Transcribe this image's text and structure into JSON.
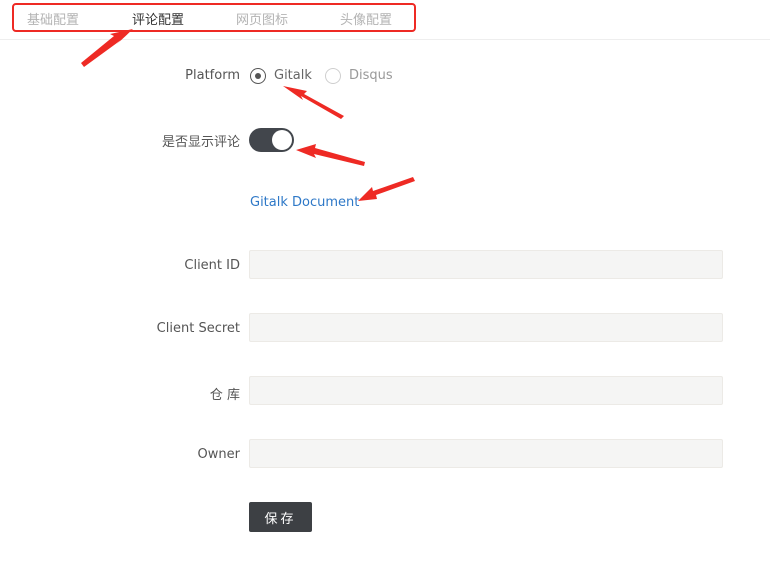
{
  "tabs": [
    {
      "label": "基础配置",
      "active": false
    },
    {
      "label": "评论配置",
      "active": true
    },
    {
      "label": "网页图标",
      "active": false
    },
    {
      "label": "头像配置",
      "active": false
    }
  ],
  "form": {
    "platform_label": "Platform",
    "platform_options": [
      {
        "label": "Gitalk",
        "checked": true
      },
      {
        "label": "Disqus",
        "checked": false
      }
    ],
    "show_comments_label": "是否显示评论",
    "show_comments_on": true,
    "doc_link": "Gitalk Document",
    "client_id_label": "Client ID",
    "client_id_value": "",
    "client_secret_label": "Client Secret",
    "client_secret_value": "",
    "repo_label": "仓 库",
    "repo_value": "",
    "owner_label": "Owner",
    "owner_value": "",
    "save_label": "保存"
  },
  "colors": {
    "annotation": "#ee2a24",
    "toggle_on": "#42464c",
    "link": "#2e78c7"
  }
}
